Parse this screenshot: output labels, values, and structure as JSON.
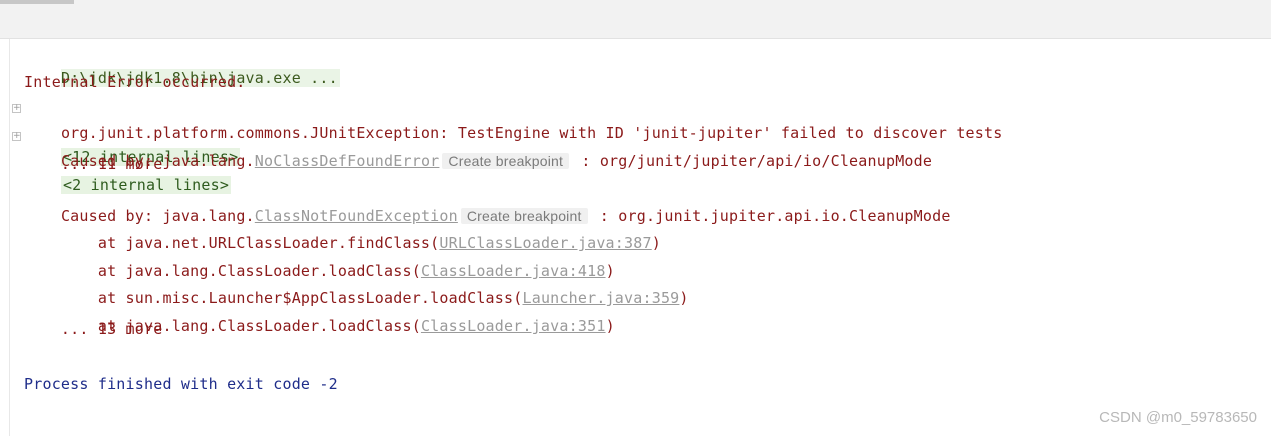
{
  "console": {
    "command": "D:\\jdk\\jdk1.8\\bin\\java.exe ...",
    "internal_error": "Internal Error occurred.",
    "exception_line": "org.junit.platform.commons.JUnitException: TestEngine with ID 'junit-jupiter' failed to discover tests",
    "exception_internal": "<12 internal lines>",
    "caused1_prefix": "Caused by: java.lang.",
    "caused1_link": "NoClassDefFoundError",
    "caused1_hint": "Create breakpoint",
    "caused1_suffix": " : org/junit/jupiter/api/io/CleanupMode",
    "caused1_internal": "<2 internal lines>",
    "more1": "    ... 11 more",
    "caused2_prefix": "Caused by: java.lang.",
    "caused2_link": "ClassNotFoundException",
    "caused2_hint": "Create breakpoint",
    "caused2_suffix": " : org.junit.jupiter.api.io.CleanupMode",
    "frames": [
      {
        "prefix": "    at java.net.URLClassLoader.findClass(",
        "link": "URLClassLoader.java:387",
        "suffix": ")"
      },
      {
        "prefix": "    at java.lang.ClassLoader.loadClass(",
        "link": "ClassLoader.java:418",
        "suffix": ")"
      },
      {
        "prefix": "    at sun.misc.Launcher$AppClassLoader.loadClass(",
        "link": "Launcher.java:359",
        "suffix": ")"
      },
      {
        "prefix": "    at java.lang.ClassLoader.loadClass(",
        "link": "ClassLoader.java:351",
        "suffix": ")"
      }
    ],
    "more2": "    ... 13 more",
    "exit": "Process finished with exit code -2"
  },
  "watermark": "CSDN @m0_59783650"
}
